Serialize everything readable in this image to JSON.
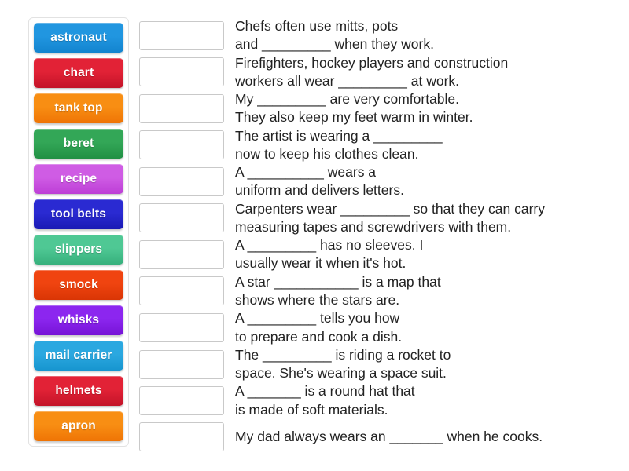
{
  "activity": {
    "type": "match-up-drag-and-drop",
    "tray_label": "word tiles"
  },
  "tiles": [
    {
      "label": "astronaut",
      "color": "#2196e0",
      "color_dark": "#1384cf"
    },
    {
      "label": "chart",
      "color": "#e22236",
      "color_dark": "#c31328"
    },
    {
      "label": "tank top",
      "color": "#f88e13",
      "color_dark": "#ef7405"
    },
    {
      "label": "beret",
      "color": "#33a757",
      "color_dark": "#219044"
    },
    {
      "label": "recipe",
      "color": "#cf5ce4",
      "color_dark": "#bd3ed6"
    },
    {
      "label": "tool belts",
      "color": "#2a2ad2",
      "color_dark": "#1a1ab4"
    },
    {
      "label": "slippers",
      "color": "#4fc894",
      "color_dark": "#36b07c"
    },
    {
      "label": "smock",
      "color": "#f04410",
      "color_dark": "#d93505"
    },
    {
      "label": "whisks",
      "color": "#8c26ef",
      "color_dark": "#7613d6"
    },
    {
      "label": "mail carrier",
      "color": "#2ba8e0",
      "color_dark": "#1795cf"
    },
    {
      "label": "helmets",
      "color": "#e22236",
      "color_dark": "#c31328"
    },
    {
      "label": "apron",
      "color": "#f88e13",
      "color_dark": "#ef7405"
    }
  ],
  "rows": [
    {
      "answer_value": "",
      "sentence": "Chefs often use mitts, pots\nand _________ when they work."
    },
    {
      "answer_value": "",
      "sentence": "Firefighters, hockey players and construction\nworkers all wear _________ at work."
    },
    {
      "answer_value": "",
      "sentence": "My _________ are very comfortable.\nThey also keep my feet warm in winter."
    },
    {
      "answer_value": "",
      "sentence": "The artist is wearing a _________\nnow to keep his clothes clean."
    },
    {
      "answer_value": "",
      "sentence": "A __________ wears a\nuniform and delivers letters."
    },
    {
      "answer_value": "",
      "sentence": "Carpenters wear _________ so that they can carry\nmeasuring tapes and screwdrivers with them."
    },
    {
      "answer_value": "",
      "sentence": "A _________ has no sleeves. I\nusually wear it when it's hot."
    },
    {
      "answer_value": "",
      "sentence": "A star ___________ is a map that\nshows where the stars are."
    },
    {
      "answer_value": "",
      "sentence": "A _________ tells you how\nto prepare and cook a dish."
    },
    {
      "answer_value": "",
      "sentence": "The _________ is riding a rocket to\nspace. She's wearing a space suit."
    },
    {
      "answer_value": "",
      "sentence": "A _______ is a round hat that\nis made of soft materials."
    },
    {
      "answer_value": "",
      "sentence": "My dad always wears an _______ when he cooks."
    }
  ]
}
